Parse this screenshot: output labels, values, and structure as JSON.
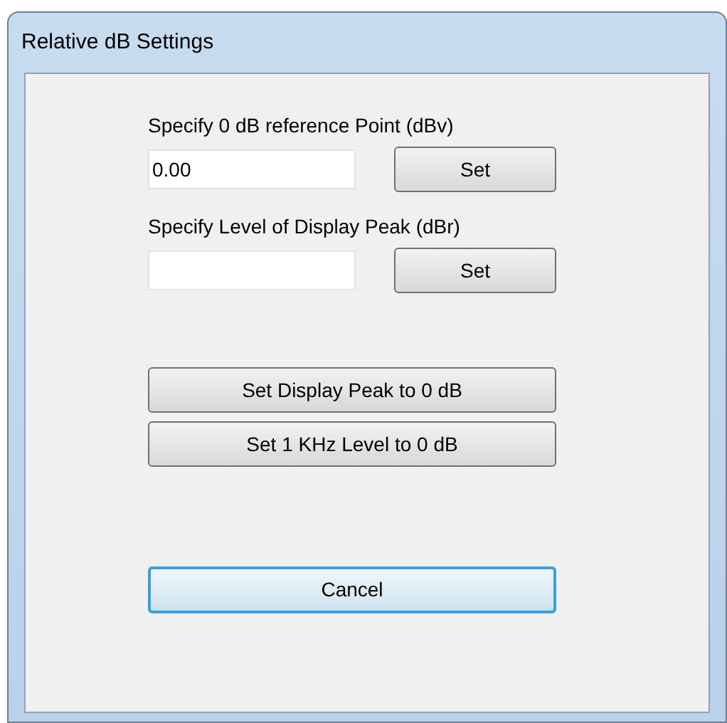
{
  "window": {
    "title": "Relative dB Settings"
  },
  "fields": [
    {
      "label": "Specify 0 dB reference Point (dBv)",
      "value": "0.00",
      "button": "Set"
    },
    {
      "label": "Specify Level of Display Peak (dBr)",
      "button": "Set"
    }
  ],
  "buttons": [
    {
      "label": "Set Display Peak to 0 dB",
      "focused": false
    },
    {
      "label": "Set 1 KHz Level to 0 dB",
      "focused": false
    }
  ],
  "cancel": {
    "label": "Cancel",
    "focused": true
  }
}
